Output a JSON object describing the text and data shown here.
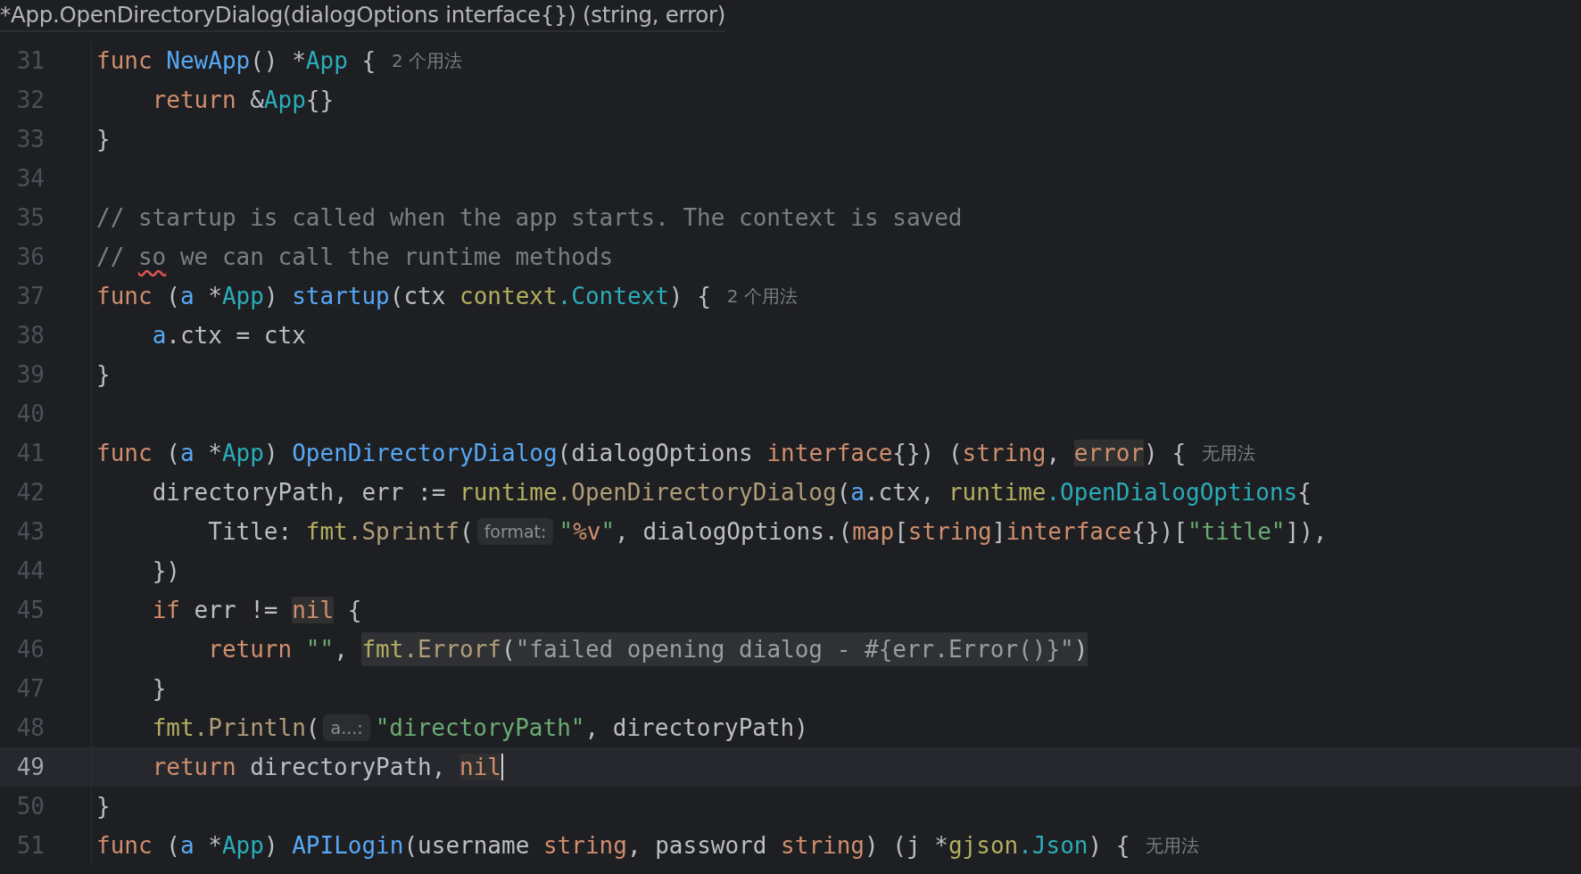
{
  "header": {
    "text": "*App.OpenDirectoryDialog(dialogOptions interface{}) (string, error)"
  },
  "lines": [
    {
      "number": "31",
      "current": false,
      "segments": [
        {
          "kind": "code",
          "tokens": [
            {
              "t": "func ",
              "kind": "kw"
            },
            {
              "t": "NewApp",
              "kind": "decl"
            },
            {
              "t": "() *",
              "kind": "p"
            },
            {
              "t": "App",
              "kind": "type"
            },
            {
              "t": " {",
              "kind": "p"
            }
          ]
        },
        {
          "kind": "usage",
          "text": "2 个用法"
        }
      ]
    },
    {
      "number": "32",
      "current": false,
      "segments": [
        {
          "kind": "code",
          "tokens": [
            {
              "t": "    return",
              "kind": "kw"
            },
            {
              "t": " &",
              "kind": "p"
            },
            {
              "t": "App",
              "kind": "type"
            },
            {
              "t": "{}",
              "kind": "p"
            }
          ]
        }
      ]
    },
    {
      "number": "33",
      "current": false,
      "segments": [
        {
          "kind": "code",
          "tokens": [
            {
              "t": "}",
              "kind": "p"
            }
          ]
        }
      ]
    },
    {
      "number": "34",
      "current": false
    },
    {
      "number": "35",
      "current": false,
      "segments": [
        {
          "kind": "code",
          "tokens": [
            {
              "t": "// startup is called when the app starts. The context is saved",
              "kind": "comment"
            }
          ]
        }
      ]
    },
    {
      "number": "36",
      "current": false,
      "segments": [
        {
          "kind": "code",
          "tokens": [
            {
              "t": "// ",
              "kind": "comment"
            },
            {
              "t": "so",
              "kind": "typo"
            },
            {
              "t": " we can call the runtime methods",
              "kind": "comment"
            }
          ]
        }
      ]
    },
    {
      "number": "37",
      "current": false,
      "segments": [
        {
          "kind": "code",
          "tokens": [
            {
              "t": "func",
              "kind": "kw"
            },
            {
              "t": " (",
              "kind": "p"
            },
            {
              "t": "a",
              "kind": "recv"
            },
            {
              "t": " *",
              "kind": "p"
            },
            {
              "t": "App",
              "kind": "type"
            },
            {
              "t": ") ",
              "kind": "p"
            },
            {
              "t": "startup",
              "kind": "decl"
            },
            {
              "t": "(ctx ",
              "kind": "p"
            },
            {
              "t": "context",
              "kind": "pkg"
            },
            {
              "t": ".Context",
              "kind": "type"
            },
            {
              "t": ") {",
              "kind": "p"
            }
          ]
        },
        {
          "kind": "usage",
          "text": "2 个用法"
        }
      ]
    },
    {
      "number": "38",
      "current": false,
      "segments": [
        {
          "kind": "code",
          "tokens": [
            {
              "t": "    a",
              "kind": "recv"
            },
            {
              "t": ".ctx = ctx",
              "kind": "p"
            }
          ]
        }
      ]
    },
    {
      "number": "39",
      "current": false,
      "segments": [
        {
          "kind": "code",
          "tokens": [
            {
              "t": "}",
              "kind": "p"
            }
          ]
        }
      ]
    },
    {
      "number": "40",
      "current": false
    },
    {
      "number": "41",
      "current": false,
      "segments": [
        {
          "kind": "code",
          "tokens": [
            {
              "t": "func",
              "kind": "kw"
            },
            {
              "t": " (",
              "kind": "p"
            },
            {
              "t": "a",
              "kind": "recv"
            },
            {
              "t": " *",
              "kind": "p"
            },
            {
              "t": "App",
              "kind": "type"
            },
            {
              "t": ") ",
              "kind": "p"
            },
            {
              "t": "OpenDirectoryDialog",
              "kind": "decl"
            },
            {
              "t": "(dialogOptions ",
              "kind": "p"
            },
            {
              "t": "interface",
              "kind": "kw"
            },
            {
              "t": "{}) (",
              "kind": "p"
            },
            {
              "t": "string",
              "kind": "kw"
            },
            {
              "t": ", ",
              "kind": "p"
            },
            {
              "t": "error",
              "kind": "mark"
            },
            {
              "t": ") {",
              "kind": "p"
            }
          ]
        },
        {
          "kind": "usage",
          "text": "无用法"
        }
      ]
    },
    {
      "number": "42",
      "current": false,
      "segments": [
        {
          "kind": "code",
          "tokens": [
            {
              "t": "    directoryPath, err := ",
              "kind": "p"
            },
            {
              "t": "runtime",
              "kind": "pkg"
            },
            {
              "t": ".OpenDirectoryDialog",
              "kind": "call"
            },
            {
              "t": "(",
              "kind": "p"
            },
            {
              "t": "a",
              "kind": "recv"
            },
            {
              "t": ".ctx, ",
              "kind": "p"
            },
            {
              "t": "runtime",
              "kind": "pkg"
            },
            {
              "t": ".OpenDialogOptions",
              "kind": "type"
            },
            {
              "t": "{",
              "kind": "p"
            }
          ]
        }
      ]
    },
    {
      "number": "43",
      "current": false,
      "segments": [
        {
          "kind": "code",
          "tokens": [
            {
              "t": "        Title: ",
              "kind": "p"
            },
            {
              "t": "fmt",
              "kind": "pkg"
            },
            {
              "t": ".Sprintf",
              "kind": "call"
            },
            {
              "t": "(",
              "kind": "p"
            }
          ]
        },
        {
          "kind": "hint",
          "text": "format:"
        },
        {
          "kind": "code",
          "tokens": [
            {
              "t": "\"",
              "kind": "str"
            },
            {
              "t": "%v",
              "kind": "kw"
            },
            {
              "t": "\"",
              "kind": "str"
            },
            {
              "t": ", dialogOptions.(",
              "kind": "p"
            },
            {
              "t": "map",
              "kind": "kw"
            },
            {
              "t": "[",
              "kind": "p"
            },
            {
              "t": "string",
              "kind": "kw"
            },
            {
              "t": "]",
              "kind": "p"
            },
            {
              "t": "interface",
              "kind": "kw"
            },
            {
              "t": "{})[",
              "kind": "p"
            },
            {
              "t": "\"title\"",
              "kind": "str"
            },
            {
              "t": "]),",
              "kind": "p"
            }
          ]
        }
      ]
    },
    {
      "number": "44",
      "current": false,
      "segments": [
        {
          "kind": "code",
          "tokens": [
            {
              "t": "    })",
              "kind": "p"
            }
          ]
        }
      ]
    },
    {
      "number": "45",
      "current": false,
      "segments": [
        {
          "kind": "code",
          "tokens": [
            {
              "t": "    if",
              "kind": "kw"
            },
            {
              "t": " err != ",
              "kind": "p"
            },
            {
              "t": "nil",
              "kind": "mark"
            },
            {
              "t": " {",
              "kind": "p"
            }
          ]
        }
      ]
    },
    {
      "number": "46",
      "current": false,
      "segments": [
        {
          "kind": "code",
          "tokens": [
            {
              "t": "        return ",
              "kind": "kw"
            },
            {
              "t": "\"\"",
              "kind": "str"
            },
            {
              "t": ", ",
              "kind": "p"
            },
            {
              "t": "fmt",
              "kind": "shpkg"
            },
            {
              "t": ".Errorf",
              "kind": "shcall"
            },
            {
              "t": "(",
              "kind": "shplain"
            },
            {
              "t": "\"failed opening dialog - #{err.Error()}\"",
              "kind": "shstr"
            },
            {
              "t": ")",
              "kind": "shplain"
            }
          ]
        }
      ]
    },
    {
      "number": "47",
      "current": false,
      "segments": [
        {
          "kind": "code",
          "tokens": [
            {
              "t": "    }",
              "kind": "p"
            }
          ]
        }
      ]
    },
    {
      "number": "48",
      "current": false,
      "segments": [
        {
          "kind": "code",
          "tokens": [
            {
              "t": "    fmt",
              "kind": "pkg"
            },
            {
              "t": ".Println",
              "kind": "call"
            },
            {
              "t": "(",
              "kind": "p"
            }
          ]
        },
        {
          "kind": "hint",
          "text": "a...:"
        },
        {
          "kind": "code",
          "tokens": [
            {
              "t": "\"directoryPath\"",
              "kind": "str"
            },
            {
              "t": ", directoryPath)",
              "kind": "p"
            }
          ]
        }
      ]
    },
    {
      "number": "49",
      "current": true,
      "segments": [
        {
          "kind": "code",
          "tokens": [
            {
              "t": "    return",
              "kind": "kw"
            },
            {
              "t": " directoryPath, ",
              "kind": "p"
            },
            {
              "t": "nil",
              "kind": "mark"
            }
          ]
        }
      ]
    },
    {
      "number": "50",
      "current": false,
      "segments": [
        {
          "kind": "code",
          "tokens": [
            {
              "t": "}",
              "kind": "p"
            }
          ]
        }
      ]
    },
    {
      "number": "51",
      "current": false,
      "segments": [
        {
          "kind": "code",
          "tokens": [
            {
              "t": "func",
              "kind": "kw"
            },
            {
              "t": " (",
              "kind": "p"
            },
            {
              "t": "a",
              "kind": "recv"
            },
            {
              "t": " *",
              "kind": "p"
            },
            {
              "t": "App",
              "kind": "type"
            },
            {
              "t": ") ",
              "kind": "p"
            },
            {
              "t": "APILogin",
              "kind": "decl"
            },
            {
              "t": "(username ",
              "kind": "p"
            },
            {
              "t": "string",
              "kind": "kw"
            },
            {
              "t": ", password ",
              "kind": "p"
            },
            {
              "t": "string",
              "kind": "kw"
            },
            {
              "t": ") (j *",
              "kind": "p"
            },
            {
              "t": "gjson",
              "kind": "pkg"
            },
            {
              "t": ".Json",
              "kind": "type"
            },
            {
              "t": ") {",
              "kind": "p"
            }
          ]
        },
        {
          "kind": "usage",
          "text": "无用法"
        }
      ]
    }
  ]
}
